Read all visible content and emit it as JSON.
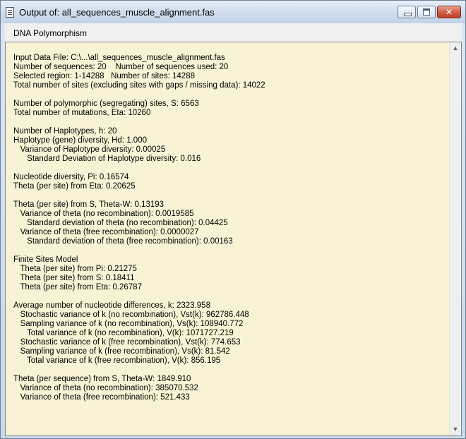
{
  "window": {
    "title": "Output of: all_sequences_muscle_alignment.fas",
    "minimize_icon": "minimize-icon",
    "maximize_icon": "maximize-icon",
    "close_icon": "close-icon",
    "close_glyph": "✕"
  },
  "menu": {
    "items": [
      "DNA Polymorphism"
    ]
  },
  "output": {
    "lines": [
      "Input Data File: C:\\...\\all_sequences_muscle_alignment.fas",
      "Number of sequences: 20    Number of sequences used: 20",
      "Selected region: 1-14288   Number of sites: 14288",
      "Total number of sites (excluding sites with gaps / missing data): 14022",
      "",
      "Number of polymorphic (segregating) sites, S: 6563",
      "Total number of mutations, Eta: 10260",
      "",
      "Number of Haplotypes, h: 20",
      "Haplotype (gene) diversity, Hd: 1.000",
      "   Variance of Haplotype diversity: 0.00025",
      "      Standard Deviation of Haplotype diversity: 0.016",
      "",
      "Nucleotide diversity, Pi: 0.16574",
      "Theta (per site) from Eta: 0.20625",
      "",
      "Theta (per site) from S, Theta-W: 0.13193",
      "   Variance of theta (no recombination): 0.0019585",
      "      Standard deviation of theta (no recombination): 0.04425",
      "   Variance of theta (free recombination): 0.0000027",
      "      Standard deviation of theta (free recombination): 0.00163",
      "",
      "Finite Sites Model",
      "   Theta (per site) from Pi: 0.21275",
      "   Theta (per site) from S: 0.18411",
      "   Theta (per site) from Eta: 0.26787",
      "",
      "Average number of nucleotide differences, k: 2323.958",
      "   Stochastic variance of k (no recombination), Vst(k): 962786.448",
      "   Sampling variance of k (no recombination), Vs(k): 108940.772",
      "      Total variance of k (no recombination), V(k): 1071727.219",
      "   Stochastic variance of k (free recombination), Vst(k): 774.653",
      "   Sampling variance of k (free recombination), Vs(k): 81.542",
      "      Total variance of k (free recombination), V(k): 856.195",
      "",
      "Theta (per sequence) from S, Theta-W: 1849.910",
      "   Variance of theta (no recombination): 385070.532",
      "   Variance of theta (free recombination): 521.433"
    ]
  },
  "scrollbar": {
    "up_icon": "scroll-up-arrow-icon",
    "down_icon": "scroll-down-arrow-icon",
    "up_glyph": "▲",
    "down_glyph": "▼"
  }
}
